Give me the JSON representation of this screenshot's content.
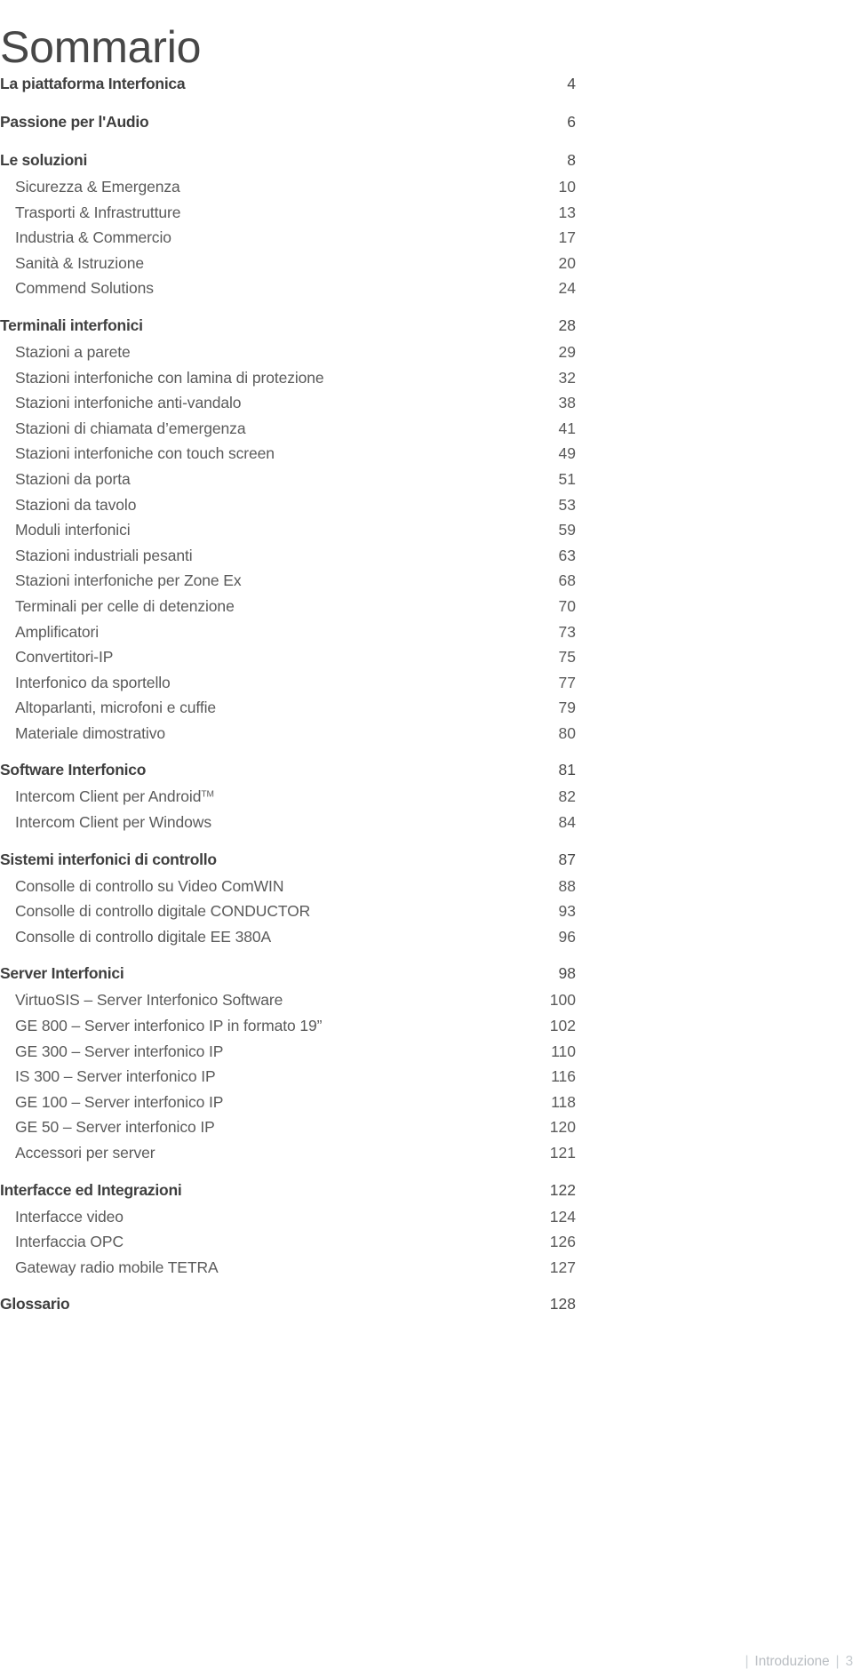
{
  "title": "Sommario",
  "footer": {
    "separator": "|",
    "section_label": "Introduzione",
    "page_number": "3"
  },
  "colors": {
    "title": "#474747",
    "section_heading": "#3f3f3f",
    "item_text": "#5a5a5a",
    "footer_text": "#b9bdc2",
    "background": "#ffffff"
  },
  "toc": {
    "groups": [
      {
        "rows": [
          {
            "type": "section",
            "label": "La piattaforma Interfonica",
            "page": "4"
          }
        ]
      },
      {
        "rows": [
          {
            "type": "section",
            "label": "Passione per l'Audio",
            "page": "6"
          }
        ]
      },
      {
        "rows": [
          {
            "type": "section",
            "label": "Le soluzioni",
            "page": "8"
          },
          {
            "type": "item",
            "label": "Sicurezza & Emergenza",
            "page": "10"
          },
          {
            "type": "item",
            "label": "Trasporti & Infrastrutture",
            "page": "13"
          },
          {
            "type": "item",
            "label": "Industria & Commercio",
            "page": "17"
          },
          {
            "type": "item",
            "label": "Sanità & Istruzione",
            "page": "20"
          },
          {
            "type": "item",
            "label": "Commend Solutions",
            "page": "24"
          }
        ]
      },
      {
        "rows": [
          {
            "type": "section",
            "label": "Terminali interfonici",
            "page": "28"
          },
          {
            "type": "item",
            "label": "Stazioni a parete",
            "page": "29"
          },
          {
            "type": "item",
            "label": "Stazioni interfoniche con lamina di protezione",
            "page": "32"
          },
          {
            "type": "item",
            "label": "Stazioni interfoniche anti-vandalo",
            "page": "38"
          },
          {
            "type": "item",
            "label": "Stazioni di chiamata d’emergenza",
            "page": "41"
          },
          {
            "type": "item",
            "label": "Stazioni interfoniche con touch screen",
            "page": "49"
          },
          {
            "type": "item",
            "label": "Stazioni da porta",
            "page": "51"
          },
          {
            "type": "item",
            "label": "Stazioni da tavolo",
            "page": "53"
          },
          {
            "type": "item",
            "label": "Moduli interfonici",
            "page": "59"
          },
          {
            "type": "item",
            "label": "Stazioni industriali pesanti",
            "page": "63"
          },
          {
            "type": "item",
            "label": "Stazioni interfoniche per Zone Ex",
            "page": "68"
          },
          {
            "type": "item",
            "label": "Terminali per celle di detenzione",
            "page": "70"
          },
          {
            "type": "item",
            "label": "Amplificatori",
            "page": "73"
          },
          {
            "type": "item",
            "label": "Convertitori-IP",
            "page": "75"
          },
          {
            "type": "item",
            "label": "Interfonico da sportello",
            "page": "77"
          },
          {
            "type": "item",
            "label": "Altoparlanti, microfoni e cuffie",
            "page": "79"
          },
          {
            "type": "item",
            "label": "Materiale dimostrativo",
            "page": "80"
          }
        ]
      },
      {
        "rows": [
          {
            "type": "section",
            "label": "Software Interfonico",
            "page": "81"
          },
          {
            "type": "item",
            "label": "Intercom Client per Android",
            "trademark": "TM",
            "page": "82"
          },
          {
            "type": "item",
            "label": "Intercom Client per Windows",
            "page": "84"
          }
        ]
      },
      {
        "rows": [
          {
            "type": "section",
            "label": "Sistemi interfonici di controllo",
            "page": "87"
          },
          {
            "type": "item",
            "label": "Consolle di controllo su Video ComWIN",
            "page": "88"
          },
          {
            "type": "item",
            "label": "Consolle di controllo digitale CONDUCTOR",
            "page": "93"
          },
          {
            "type": "item",
            "label": "Consolle di controllo digitale EE 380A",
            "page": "96"
          }
        ]
      },
      {
        "rows": [
          {
            "type": "section",
            "label": "Server Interfonici",
            "page": "98"
          },
          {
            "type": "item",
            "label": "VirtuoSIS – Server Interfonico Software",
            "page": "100"
          },
          {
            "type": "item",
            "label": "GE 800 – Server interfonico IP in formato 19”",
            "page": "102"
          },
          {
            "type": "item",
            "label": "GE 300 – Server interfonico IP",
            "page": "110"
          },
          {
            "type": "item",
            "label": "IS 300 – Server interfonico IP",
            "page": "116"
          },
          {
            "type": "item",
            "label": "GE 100 – Server interfonico IP",
            "page": "118"
          },
          {
            "type": "item",
            "label": "GE 50 – Server interfonico IP",
            "page": "120"
          },
          {
            "type": "item",
            "label": "Accessori per server",
            "page": "121"
          }
        ]
      },
      {
        "rows": [
          {
            "type": "section",
            "label": "Interfacce ed Integrazioni",
            "page": "122"
          },
          {
            "type": "item",
            "label": "Interfacce video",
            "page": "124"
          },
          {
            "type": "item",
            "label": "Interfaccia OPC",
            "page": "126"
          },
          {
            "type": "item",
            "label": "Gateway radio mobile TETRA",
            "page": "127"
          }
        ]
      },
      {
        "rows": [
          {
            "type": "section",
            "label": "Glossario",
            "page": "128"
          }
        ]
      }
    ]
  }
}
